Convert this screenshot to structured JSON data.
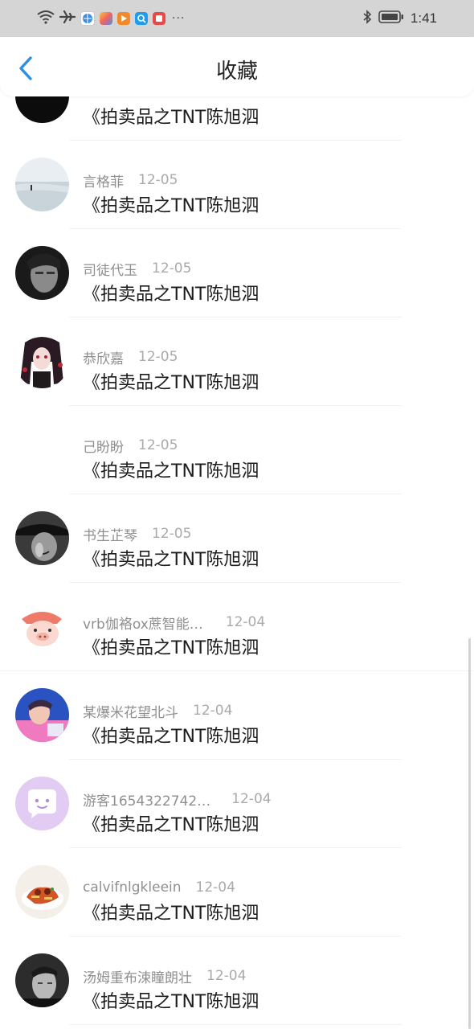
{
  "status_bar": {
    "time": "1:41",
    "left_icons": [
      "wifi-icon",
      "airplane-icon",
      "browser-app-icon",
      "tiles-app-icon",
      "play-app-icon",
      "search-app-icon",
      "red-app-icon"
    ],
    "more": "···",
    "right_icons": [
      "bluetooth-icon",
      "battery-icon"
    ]
  },
  "header": {
    "title": "收藏",
    "back_icon": "chevron-left-icon",
    "accent": "#2a8fe6"
  },
  "favorites": [
    {
      "name": "",
      "date": "",
      "text": "《拍卖品之TNT陈旭泗",
      "avatar": "dark-banner-avatar"
    },
    {
      "name": "言格菲",
      "date": "12-05",
      "text": "《拍卖品之TNT陈旭泗",
      "avatar": "beach-avatar"
    },
    {
      "name": "司徒代玉",
      "date": "12-05",
      "text": "《拍卖品之TNT陈旭泗",
      "avatar": "bw-portrait-avatar"
    },
    {
      "name": "恭欣嘉",
      "date": "12-05",
      "text": "《拍卖品之TNT陈旭泗",
      "avatar": "anime-girl-avatar"
    },
    {
      "name": "己盼盼",
      "date": "12-05",
      "text": "《拍卖品之TNT陈旭泗",
      "avatar": "empty-avatar"
    },
    {
      "name": "书生芷琴",
      "date": "12-05",
      "text": "《拍卖品之TNT陈旭泗",
      "avatar": "hat-portrait-avatar"
    },
    {
      "name": "vrb伽袼ox蔗智能…",
      "date": "12-04",
      "text": "《拍卖品之TNT陈旭泗",
      "avatar": "pig-cartoon-avatar"
    },
    {
      "name": "某爆米花望北斗",
      "date": "12-04",
      "text": "《拍卖品之TNT陈旭泗",
      "avatar": "colorful-portrait-avatar"
    },
    {
      "name": "游客1654322742…",
      "date": "12-04",
      "text": "《拍卖品之TNT陈旭泗",
      "avatar": "chat-bubble-avatar"
    },
    {
      "name": "calvifnlgkleein",
      "date": "12-04",
      "text": "《拍卖品之TNT陈旭泗",
      "avatar": "food-avatar"
    },
    {
      "name": "汤姆重布涑瞳朗壮",
      "date": "12-04",
      "text": "《拍卖品之TNT陈旭泗",
      "avatar": "man-portrait-avatar"
    }
  ]
}
